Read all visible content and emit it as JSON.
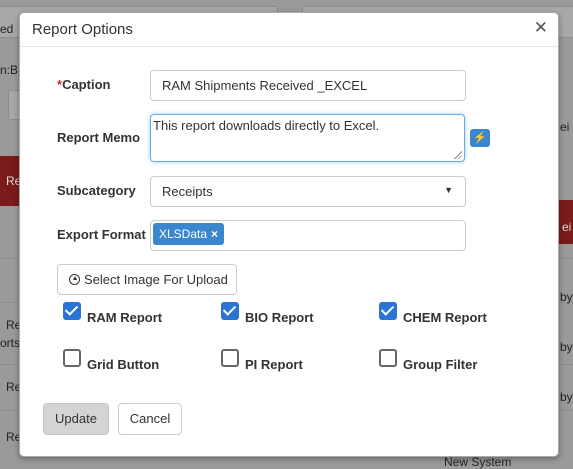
{
  "background": {
    "fragments": [
      "ed",
      "n:B",
      "Re",
      "Re",
      "orts",
      "Re",
      "Re",
      "ei",
      "by",
      "ei",
      "by",
      "by",
      "New System"
    ]
  },
  "dialog": {
    "title": "Report Options",
    "close_icon": "close-icon",
    "caption": {
      "required_mark": "*",
      "label": "Caption",
      "value": "RAM Shipments Received _EXCEL"
    },
    "memo": {
      "label": "Report Memo",
      "value": "This report downloads directly to Excel.",
      "action_icon": "lightning-icon"
    },
    "subcategory": {
      "label": "Subcategory",
      "selected": "Receipts"
    },
    "export_format": {
      "label": "Export Format",
      "tags": [
        {
          "text": "XLSData",
          "remove": "×"
        }
      ]
    },
    "upload": {
      "icon": "upload-circle-icon",
      "label": "Select Image For Upload"
    },
    "checkboxes": [
      {
        "label": "RAM Report",
        "checked": true
      },
      {
        "label": "BIO Report",
        "checked": true
      },
      {
        "label": "CHEM Report",
        "checked": true
      },
      {
        "label": "Grid Button",
        "checked": false
      },
      {
        "label": "PI Report",
        "checked": false
      },
      {
        "label": "Group Filter",
        "checked": false
      }
    ],
    "buttons": {
      "update": "Update",
      "cancel": "Cancel"
    }
  },
  "colors": {
    "accent": "#3a87cf",
    "checkbox": "#2a74d5",
    "required": "#c9302c"
  }
}
